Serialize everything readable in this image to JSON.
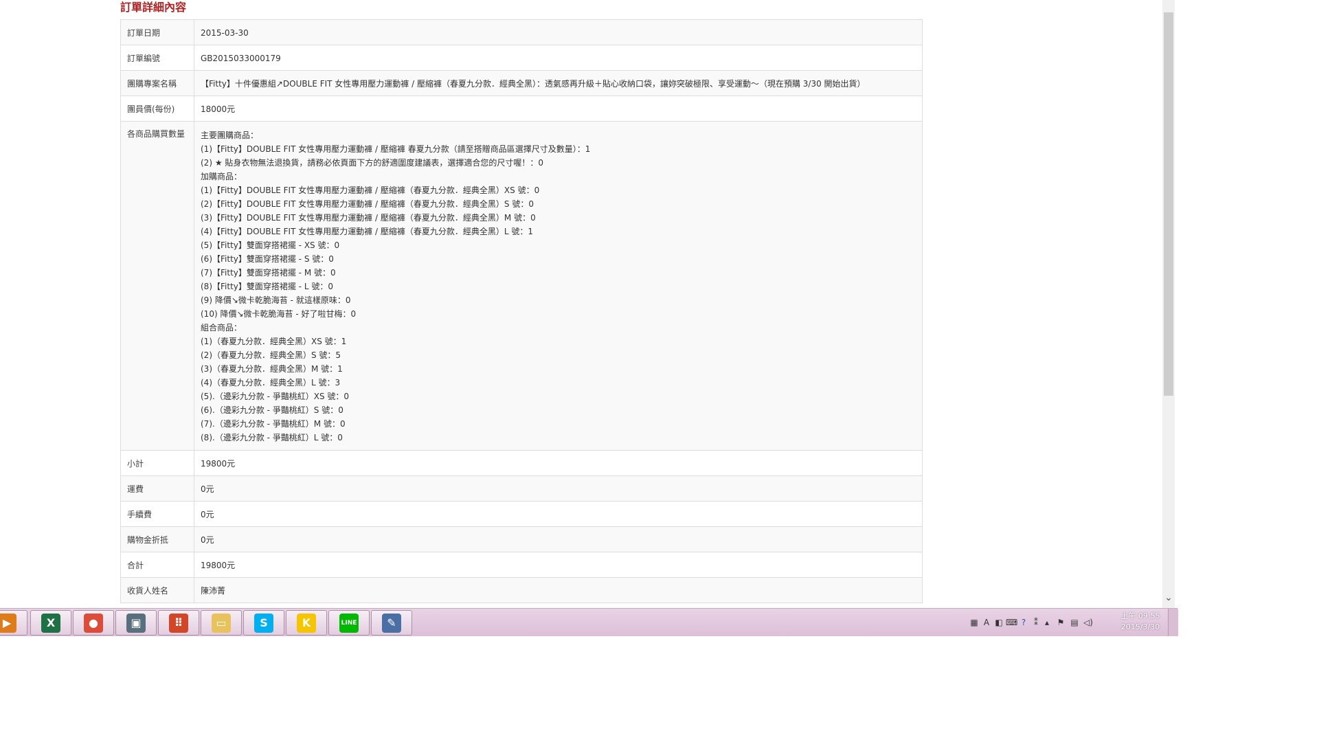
{
  "section_title": "訂單詳細內容",
  "rows": [
    {
      "label": "訂單日期",
      "value": "2015-03-30"
    },
    {
      "label": "訂單編號",
      "value": "GB2015033000179"
    },
    {
      "label": "團購專案名稱",
      "value": "【Fitty】十件優惠組↗DOUBLE FIT 女性專用壓力運動褲 / 壓縮褲（春夏九分款．經典全黑）：透氣感再升級＋貼心收納口袋，讓妳突破極限、享受運動～（現在預購 3/30 開始出貨）"
    },
    {
      "label": "團員價(每份)",
      "value": "18000元"
    }
  ],
  "quantity_row": {
    "label": "各商品購買數量",
    "lines": [
      "主要團購商品：",
      "(1)【Fitty】DOUBLE FIT 女性專用壓力運動褲 / 壓縮褲 春夏九分款（請至搭贈商品區選擇尺寸及數量）：1",
      "(2) ★ 貼身衣物無法退換貨，請務必依頁面下方的舒適圍度建議表，選擇適合您的尺寸喔！：0",
      "加購商品：",
      "(1)【Fitty】DOUBLE FIT 女性專用壓力運動褲 / 壓縮褲（春夏九分款．經典全黑）XS 號：0",
      "(2)【Fitty】DOUBLE FIT 女性專用壓力運動褲 / 壓縮褲（春夏九分款．經典全黑）S 號：0",
      "(3)【Fitty】DOUBLE FIT 女性專用壓力運動褲 / 壓縮褲（春夏九分款．經典全黑）M 號：0",
      "(4)【Fitty】DOUBLE FIT 女性專用壓力運動褲 / 壓縮褲（春夏九分款．經典全黑）L 號：1",
      "(5)【Fitty】雙面穿搭裙擺 - XS 號：0",
      "(6)【Fitty】雙面穿搭裙擺 - S 號：0",
      "(7)【Fitty】雙面穿搭裙擺 - M 號：0",
      "(8)【Fitty】雙面穿搭裙擺 - L 號：0",
      "(9) 降價↘微卡乾脆海苔 - 就這樣原味：0",
      "(10) 降價↘微卡乾脆海苔 - 好了啦甘梅：0",
      "組合商品：",
      "(1)（春夏九分款．經典全黑）XS 號：1",
      "(2)（春夏九分款．經典全黑）S 號：5",
      "(3)（春夏九分款．經典全黑）M 號：1",
      "(4)（春夏九分款．經典全黑）L 號：3",
      "(5).（邊彩九分款 - 爭豔桃紅）XS 號：0",
      "(6).（邊彩九分款 - 爭豔桃紅）S 號：0",
      "(7).（邊彩九分款 - 爭豔桃紅）M 號：0",
      "(8).（邊彩九分款 - 爭豔桃紅）L 號：0"
    ]
  },
  "rows_after": [
    {
      "label": "小計",
      "value": "19800元"
    },
    {
      "label": "運費",
      "value": "0元"
    },
    {
      "label": "手續費",
      "value": "0元"
    },
    {
      "label": "購物金折抵",
      "value": "0元"
    },
    {
      "label": "合計",
      "value": "19800元"
    },
    {
      "label": "收貨人姓名",
      "value": "陳沛菁"
    }
  ],
  "taskbar": {
    "apps": [
      {
        "name": "media-player-icon",
        "glyph": "▶",
        "color": "#e07b1a"
      },
      {
        "name": "excel-icon",
        "glyph": "X",
        "color": "#1e7145"
      },
      {
        "name": "chrome-icon",
        "glyph": "●",
        "color": "#dd4b39"
      },
      {
        "name": "window-app-icon",
        "glyph": "▣",
        "color": "#5a6f7e"
      },
      {
        "name": "apps-grid-icon",
        "glyph": "⠿",
        "color": "#d24726"
      },
      {
        "name": "folder-icon",
        "glyph": "▭",
        "color": "#e8c25a"
      },
      {
        "name": "skype-icon",
        "glyph": "S",
        "color": "#00aff0"
      },
      {
        "name": "kakao-icon",
        "glyph": "K",
        "color": "#f5c600"
      },
      {
        "name": "line-icon",
        "glyph": "LINE",
        "color": "#00b900"
      },
      {
        "name": "paint-icon",
        "glyph": "✎",
        "color": "#4a6fa5"
      }
    ],
    "clock_time": "上午 09:55",
    "clock_date": "2015/3/30"
  }
}
